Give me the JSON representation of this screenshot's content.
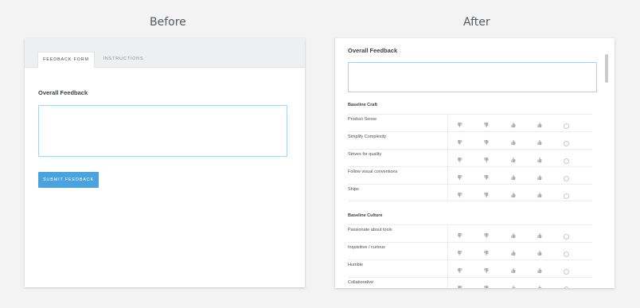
{
  "headings": {
    "before": "Before",
    "after": "After"
  },
  "before": {
    "tabs": [
      {
        "label": "FEEDBACK FORM"
      },
      {
        "label": "INSTRUCTIONS"
      }
    ],
    "title": "Overall Feedback",
    "textarea_value": "",
    "submit_label": "SUBMIT FEEDBACK"
  },
  "after": {
    "title": "Overall Feedback",
    "textarea_value": "",
    "sections": [
      {
        "title": "Baseline Craft",
        "rows": [
          "Product Sense",
          "Simplify Complexity",
          "Strives for quality",
          "Follow visual conventions",
          "Ships"
        ]
      },
      {
        "title": "Baseline Culture",
        "rows": [
          "Passionate about tools",
          "Inquisitive / curious",
          "Humble",
          "Collaborative"
        ]
      }
    ],
    "rating_icons": [
      "thumbs-down-double-icon",
      "thumbs-down-icon",
      "thumbs-up-icon",
      "thumbs-up-double-icon",
      "no-opinion-radio-icon"
    ]
  },
  "colors": {
    "accent": "#4aa3df",
    "field_border": "#a9d1ec",
    "background": "#f3f3f3"
  }
}
